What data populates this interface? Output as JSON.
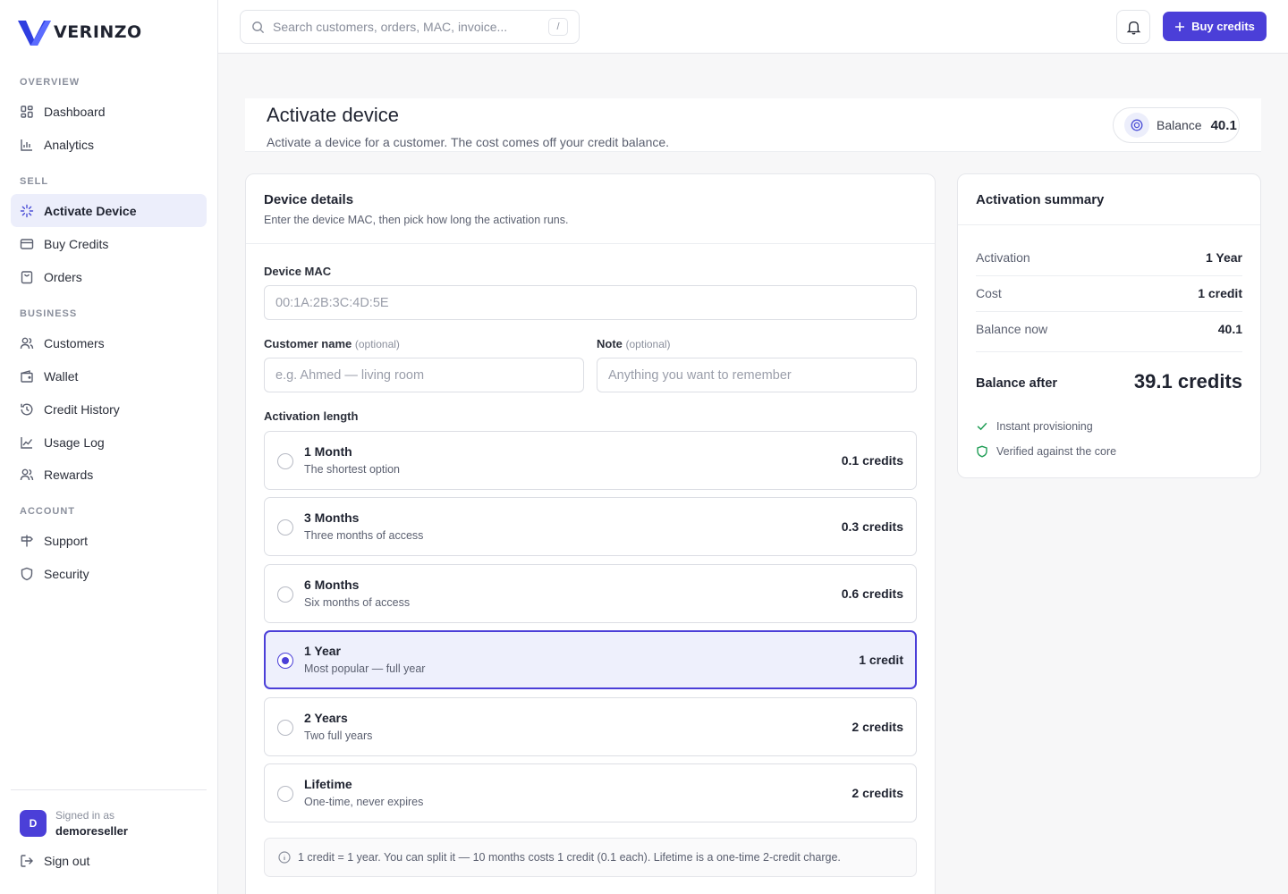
{
  "brand": {
    "name": "VERINZO"
  },
  "sidebar": {
    "sections": [
      "OVERVIEW",
      "SELL",
      "BUSINESS",
      "ACCOUNT"
    ],
    "items": [
      {
        "label": "Dashboard",
        "icon": "grid-icon"
      },
      {
        "label": "Analytics",
        "icon": "bar-chart-icon"
      },
      {
        "label": "Activate Device",
        "icon": "sparkle-icon",
        "active": true
      },
      {
        "label": "Buy Credits",
        "icon": "card-icon"
      },
      {
        "label": "Orders",
        "icon": "bag-icon"
      },
      {
        "label": "Customers",
        "icon": "users-icon"
      },
      {
        "label": "Wallet",
        "icon": "wallet-icon"
      },
      {
        "label": "Credit History",
        "icon": "history-icon"
      },
      {
        "label": "Usage Log",
        "icon": "line-chart-icon"
      },
      {
        "label": "Rewards",
        "icon": "users-icon"
      },
      {
        "label": "Support",
        "icon": "signpost-icon"
      },
      {
        "label": "Security",
        "icon": "shield-icon"
      }
    ],
    "user": {
      "initial": "D",
      "signed_in_label": "Signed in as",
      "username": "demoreseller"
    },
    "signout_label": "Sign out"
  },
  "topbar": {
    "search_placeholder": "Search customers, orders, MAC, invoice...",
    "search_shortcut": "/",
    "buy_credits_label": "Buy credits"
  },
  "page": {
    "title": "Activate device",
    "subtitle": "Activate a device for a customer. The cost comes off your credit balance.",
    "balance_label": "Balance",
    "balance_value": "40.1"
  },
  "details": {
    "title": "Device details",
    "subtitle": "Enter the device MAC, then pick how long the activation runs.",
    "mac_label": "Device MAC",
    "mac_placeholder": "00:1A:2B:3C:4D:5E",
    "customer_label": "Customer name",
    "customer_optional": "(optional)",
    "customer_placeholder": "e.g. Ahmed — living room",
    "note_label": "Note",
    "note_optional": "(optional)",
    "note_placeholder": "Anything you want to remember",
    "length_label": "Activation length",
    "options": [
      {
        "title": "1 Month",
        "desc": "The shortest option",
        "price": "0.1 credits",
        "selected": false
      },
      {
        "title": "3 Months",
        "desc": "Three months of access",
        "price": "0.3 credits",
        "selected": false
      },
      {
        "title": "6 Months",
        "desc": "Six months of access",
        "price": "0.6 credits",
        "selected": false
      },
      {
        "title": "1 Year",
        "desc": "Most popular — full year",
        "price": "1 credit",
        "selected": true
      },
      {
        "title": "2 Years",
        "desc": "Two full years",
        "price": "2 credits",
        "selected": false
      },
      {
        "title": "Lifetime",
        "desc": "One-time, never expires",
        "price": "2 credits",
        "selected": false
      }
    ],
    "info_note": "1 credit = 1 year. You can split it — 10 months costs 1 credit (0.1 each). Lifetime is a one-time 2-credit charge."
  },
  "summary": {
    "title": "Activation summary",
    "rows": [
      {
        "key": "Activation",
        "value": "1 Year"
      },
      {
        "key": "Cost",
        "value": "1 credit"
      },
      {
        "key": "Balance now",
        "value": "40.1"
      }
    ],
    "after_label": "Balance after",
    "after_value": "39.1 credits",
    "features": [
      "Instant provisioning",
      "Verified against the core"
    ]
  },
  "colors": {
    "accent": "#4b3fd8",
    "success": "#1f9d55"
  }
}
